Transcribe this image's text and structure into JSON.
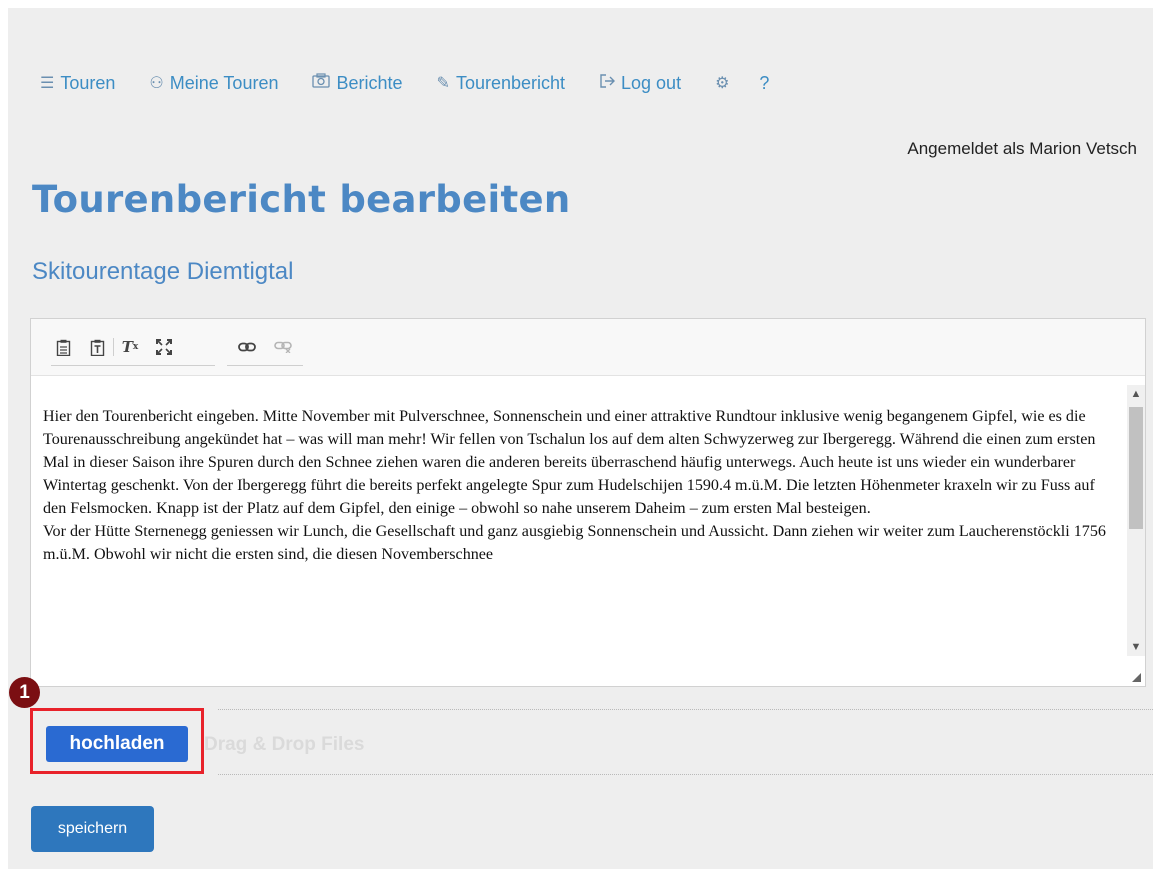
{
  "nav": {
    "items": [
      {
        "icon": "list-icon",
        "label": "Touren"
      },
      {
        "icon": "hikers-icon",
        "label": "Meine Touren"
      },
      {
        "icon": "camera-icon",
        "label": "Berichte"
      },
      {
        "icon": "pen-icon",
        "label": "Tourenbericht"
      },
      {
        "icon": "logout-icon",
        "label": "Log out"
      }
    ],
    "settings_icon": "gear-icon",
    "help_label": "?"
  },
  "user": {
    "logged_in_text": "Angemeldet als Marion Vetsch"
  },
  "page": {
    "title": "Tourenbericht bearbeiten",
    "subtitle": "Skitourentage Diemtigtal"
  },
  "editor": {
    "toolbar": [
      {
        "icon": "paste-icon"
      },
      {
        "icon": "paste-text-icon"
      },
      {
        "icon": "remove-format-icon"
      },
      {
        "icon": "maximize-icon"
      },
      {
        "icon": "link-icon"
      },
      {
        "icon": "unlink-icon"
      }
    ],
    "paragraphs": [
      "Hier den Tourenbericht eingeben. Mitte November mit Pulverschnee, Sonnenschein und einer attraktive Rundtour inklusive wenig begangenem Gipfel, wie es die Tourenausschreibung angekündet hat – was will man mehr! Wir fellen von Tschalun los auf dem alten Schwyzerweg zur Ibergeregg. Während die einen zum ersten Mal in dieser Saison ihre Spuren durch den Schnee ziehen waren die anderen bereits überraschend häufig unterwegs. Auch heute ist uns wieder ein wunderbarer Wintertag geschenkt. Von der Ibergeregg führt die bereits perfekt angelegte Spur zum Hudelschijen 1590.4 m.ü.M. Die letzten Höhenmeter kraxeln wir zu Fuss auf den Felsmocken. Knapp ist der Platz auf dem Gipfel, den einige – obwohl so nahe unserem Daheim – zum ersten Mal besteigen.",
      "Vor der Hütte Sternenegg geniessen wir Lunch, die Gesellschaft und ganz ausgiebig Sonnenschein und Aussicht. Dann ziehen wir weiter zum Laucherenstöckli 1756 m.ü.M. Obwohl wir nicht die ersten sind, die diesen Novemberschnee"
    ]
  },
  "upload": {
    "button_label": "hochladen",
    "drop_text": "Drag & Drop Files",
    "badge_number": "1"
  },
  "save": {
    "button_label": "speichern"
  },
  "colors": {
    "accent": "#4c88c4",
    "link": "#3c8dc4",
    "upload_button": "#2a6ad2",
    "save_button": "#2e77bd",
    "highlight": "#e8222a",
    "badge": "#7b0f12"
  }
}
